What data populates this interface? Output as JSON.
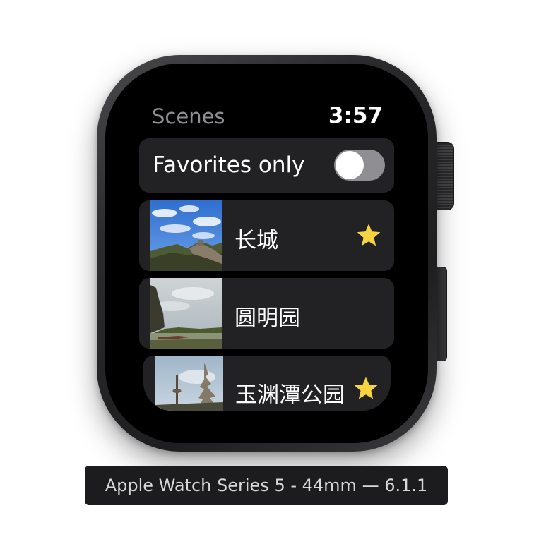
{
  "device": {
    "label": "Apple Watch Series 5 - 44mm — 6.1.1"
  },
  "app": {
    "title": "Scenes",
    "time": "3:57"
  },
  "favorites_toggle": {
    "label": "Favorites only",
    "on": false
  },
  "scenes": [
    {
      "name": "长城",
      "favorite": true,
      "thumbnail": "great-wall-photo"
    },
    {
      "name": "圆明园",
      "favorite": false,
      "thumbnail": "yuanmingyuan-photo"
    },
    {
      "name": "玉渊潭公园",
      "favorite": true,
      "thumbnail": "yuyuantan-park-photo"
    }
  ],
  "colors": {
    "accent_star": "#f6d441",
    "row_background": "#222224",
    "switch_off": "#8e8e93"
  }
}
